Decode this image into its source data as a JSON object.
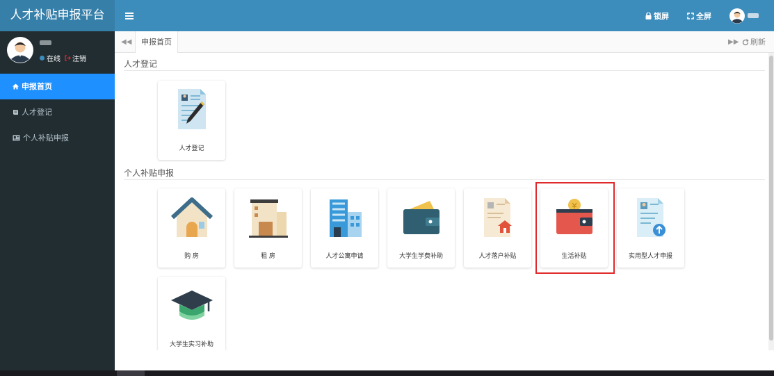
{
  "app": {
    "title": "人才补贴申报平台"
  },
  "topbar": {
    "menu_icon": "hamburger-icon",
    "lock_label": "锁屏",
    "fullscreen_label": "全屏",
    "accent": "#3c8dbc"
  },
  "sidebar": {
    "status_online": "在线",
    "logout_label": "注销",
    "items": [
      {
        "label": "申报首页",
        "icon": "home-icon",
        "active": true
      },
      {
        "label": "人才登记",
        "icon": "book-icon",
        "active": false
      },
      {
        "label": "个人补贴申报",
        "icon": "id-card-icon",
        "active": false
      }
    ]
  },
  "tabs": {
    "items": [
      {
        "label": "申报首页"
      }
    ],
    "refresh_label": "刷新"
  },
  "sections": [
    {
      "title": "人才登记",
      "tiles": [
        {
          "label": "人才登记",
          "icon": "registration-form-icon"
        }
      ]
    },
    {
      "title": "个人补贴申报",
      "tiles": [
        {
          "label": "购 房",
          "icon": "house-icon"
        },
        {
          "label": "租 房",
          "icon": "rental-building-icon"
        },
        {
          "label": "人才公寓申请",
          "icon": "apartment-icon"
        },
        {
          "label": "大学生学费补助",
          "icon": "tuition-wallet-icon"
        },
        {
          "label": "人才落户补贴",
          "icon": "household-registration-icon"
        },
        {
          "label": "生活补贴",
          "icon": "living-wallet-icon",
          "highlighted": true
        },
        {
          "label": "实用型人才申报",
          "icon": "practical-talent-icon"
        },
        {
          "label": "大学生实习补助",
          "icon": "graduation-cap-icon"
        }
      ]
    }
  ],
  "colors": {
    "sidebar_bg": "#222d32",
    "active_nav": "#1e90ff",
    "highlight_border": "#e0292a"
  }
}
